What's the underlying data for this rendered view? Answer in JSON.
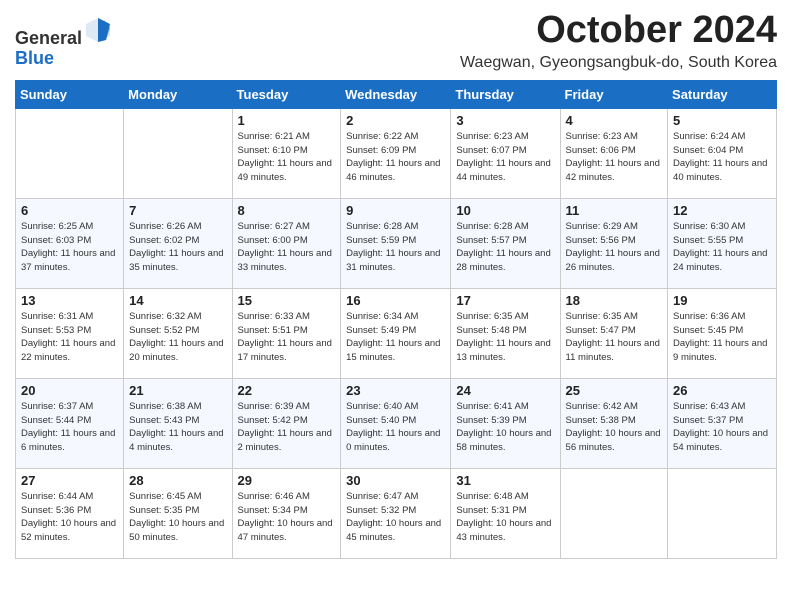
{
  "logo": {
    "general": "General",
    "blue": "Blue"
  },
  "header": {
    "month": "October 2024",
    "location": "Waegwan, Gyeongsangbuk-do, South Korea"
  },
  "days_of_week": [
    "Sunday",
    "Monday",
    "Tuesday",
    "Wednesday",
    "Thursday",
    "Friday",
    "Saturday"
  ],
  "weeks": [
    [
      {
        "day": "",
        "info": ""
      },
      {
        "day": "",
        "info": ""
      },
      {
        "day": "1",
        "info": "Sunrise: 6:21 AM\nSunset: 6:10 PM\nDaylight: 11 hours\nand 49 minutes."
      },
      {
        "day": "2",
        "info": "Sunrise: 6:22 AM\nSunset: 6:09 PM\nDaylight: 11 hours\nand 46 minutes."
      },
      {
        "day": "3",
        "info": "Sunrise: 6:23 AM\nSunset: 6:07 PM\nDaylight: 11 hours\nand 44 minutes."
      },
      {
        "day": "4",
        "info": "Sunrise: 6:23 AM\nSunset: 6:06 PM\nDaylight: 11 hours\nand 42 minutes."
      },
      {
        "day": "5",
        "info": "Sunrise: 6:24 AM\nSunset: 6:04 PM\nDaylight: 11 hours\nand 40 minutes."
      }
    ],
    [
      {
        "day": "6",
        "info": "Sunrise: 6:25 AM\nSunset: 6:03 PM\nDaylight: 11 hours\nand 37 minutes."
      },
      {
        "day": "7",
        "info": "Sunrise: 6:26 AM\nSunset: 6:02 PM\nDaylight: 11 hours\nand 35 minutes."
      },
      {
        "day": "8",
        "info": "Sunrise: 6:27 AM\nSunset: 6:00 PM\nDaylight: 11 hours\nand 33 minutes."
      },
      {
        "day": "9",
        "info": "Sunrise: 6:28 AM\nSunset: 5:59 PM\nDaylight: 11 hours\nand 31 minutes."
      },
      {
        "day": "10",
        "info": "Sunrise: 6:28 AM\nSunset: 5:57 PM\nDaylight: 11 hours\nand 28 minutes."
      },
      {
        "day": "11",
        "info": "Sunrise: 6:29 AM\nSunset: 5:56 PM\nDaylight: 11 hours\nand 26 minutes."
      },
      {
        "day": "12",
        "info": "Sunrise: 6:30 AM\nSunset: 5:55 PM\nDaylight: 11 hours\nand 24 minutes."
      }
    ],
    [
      {
        "day": "13",
        "info": "Sunrise: 6:31 AM\nSunset: 5:53 PM\nDaylight: 11 hours\nand 22 minutes."
      },
      {
        "day": "14",
        "info": "Sunrise: 6:32 AM\nSunset: 5:52 PM\nDaylight: 11 hours\nand 20 minutes."
      },
      {
        "day": "15",
        "info": "Sunrise: 6:33 AM\nSunset: 5:51 PM\nDaylight: 11 hours\nand 17 minutes."
      },
      {
        "day": "16",
        "info": "Sunrise: 6:34 AM\nSunset: 5:49 PM\nDaylight: 11 hours\nand 15 minutes."
      },
      {
        "day": "17",
        "info": "Sunrise: 6:35 AM\nSunset: 5:48 PM\nDaylight: 11 hours\nand 13 minutes."
      },
      {
        "day": "18",
        "info": "Sunrise: 6:35 AM\nSunset: 5:47 PM\nDaylight: 11 hours\nand 11 minutes."
      },
      {
        "day": "19",
        "info": "Sunrise: 6:36 AM\nSunset: 5:45 PM\nDaylight: 11 hours\nand 9 minutes."
      }
    ],
    [
      {
        "day": "20",
        "info": "Sunrise: 6:37 AM\nSunset: 5:44 PM\nDaylight: 11 hours\nand 6 minutes."
      },
      {
        "day": "21",
        "info": "Sunrise: 6:38 AM\nSunset: 5:43 PM\nDaylight: 11 hours\nand 4 minutes."
      },
      {
        "day": "22",
        "info": "Sunrise: 6:39 AM\nSunset: 5:42 PM\nDaylight: 11 hours\nand 2 minutes."
      },
      {
        "day": "23",
        "info": "Sunrise: 6:40 AM\nSunset: 5:40 PM\nDaylight: 11 hours\nand 0 minutes."
      },
      {
        "day": "24",
        "info": "Sunrise: 6:41 AM\nSunset: 5:39 PM\nDaylight: 10 hours\nand 58 minutes."
      },
      {
        "day": "25",
        "info": "Sunrise: 6:42 AM\nSunset: 5:38 PM\nDaylight: 10 hours\nand 56 minutes."
      },
      {
        "day": "26",
        "info": "Sunrise: 6:43 AM\nSunset: 5:37 PM\nDaylight: 10 hours\nand 54 minutes."
      }
    ],
    [
      {
        "day": "27",
        "info": "Sunrise: 6:44 AM\nSunset: 5:36 PM\nDaylight: 10 hours\nand 52 minutes."
      },
      {
        "day": "28",
        "info": "Sunrise: 6:45 AM\nSunset: 5:35 PM\nDaylight: 10 hours\nand 50 minutes."
      },
      {
        "day": "29",
        "info": "Sunrise: 6:46 AM\nSunset: 5:34 PM\nDaylight: 10 hours\nand 47 minutes."
      },
      {
        "day": "30",
        "info": "Sunrise: 6:47 AM\nSunset: 5:32 PM\nDaylight: 10 hours\nand 45 minutes."
      },
      {
        "day": "31",
        "info": "Sunrise: 6:48 AM\nSunset: 5:31 PM\nDaylight: 10 hours\nand 43 minutes."
      },
      {
        "day": "",
        "info": ""
      },
      {
        "day": "",
        "info": ""
      }
    ]
  ]
}
